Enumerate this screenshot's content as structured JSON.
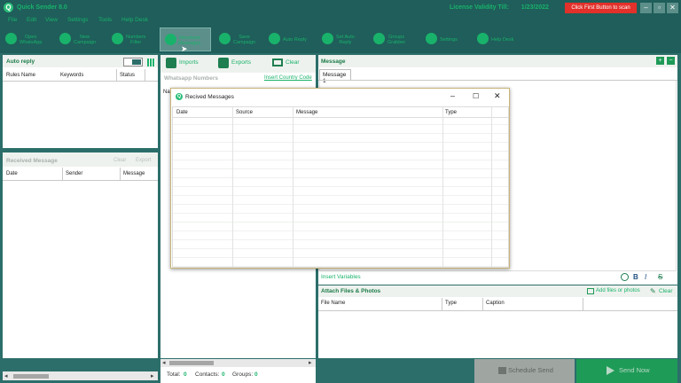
{
  "app": {
    "title": "Quick Sender 8.0",
    "license_label": "License Validity Till:",
    "license_date": "1/23/2022",
    "scan_button": "Click First Button to scan",
    "logo_letter": "Q"
  },
  "menu": [
    "File",
    "Edit",
    "View",
    "Settings",
    "Tools",
    "Help Desk"
  ],
  "toolbar": [
    {
      "label": "Open\nWhatsApp",
      "icon": "whatsapp-icon"
    },
    {
      "label": "New\nCampaign",
      "icon": "plus-icon"
    },
    {
      "label": "Numbers\nFilter",
      "icon": "filter-icon"
    },
    {
      "label": "Received\nMessages",
      "icon": "message-icon"
    },
    {
      "label": "Save\nCampaign",
      "icon": "save-icon"
    },
    {
      "label": "Auto Reply",
      "icon": "headset-icon"
    },
    {
      "label": "Set Auto\nReply",
      "icon": "network-icon"
    },
    {
      "label": "Groups\nGrabber",
      "icon": "groups-icon"
    },
    {
      "label": "Settings",
      "icon": "settings-icon"
    },
    {
      "label": "Help Desk",
      "icon": "cloud-icon"
    }
  ],
  "auto_reply": {
    "title": "Auto reply",
    "columns": [
      "Rules Name",
      "Keywords",
      "Status"
    ]
  },
  "received": {
    "title": "Received Message",
    "clear": "Clear",
    "export": "Export",
    "columns": [
      "Date",
      "Sender",
      "Message"
    ]
  },
  "numbers": {
    "imports": "Imports",
    "exports": "Exports",
    "clear": "Clear",
    "title": "Whatsapp Numbers",
    "insert_code": "Insert Country Code",
    "name_col": "Na",
    "total_label": "Total:",
    "total": "0",
    "contacts_label": "Contacts:",
    "contacts": "0",
    "groups_label": "Groups:",
    "groups": "0"
  },
  "message": {
    "title": "Message",
    "tab": "Message 1",
    "insert_variables": "Insert Variables",
    "format_b": "B",
    "format_i": "I",
    "format_s": "S"
  },
  "attach": {
    "title": "Attach Files & Photos",
    "add": "Add files or photos",
    "clear": "Clear",
    "columns": [
      "File Name",
      "Type",
      "Caption"
    ]
  },
  "actions": {
    "schedule": "Schedule Send",
    "send": "Send Now"
  },
  "dialog": {
    "title": "Recived Messages",
    "columns": [
      "Date",
      "Source",
      "Message",
      "Type"
    ]
  },
  "colors": {
    "brand_green": "#19b26b",
    "dark_teal": "#1f5e5a",
    "alert_red": "#e2302a"
  }
}
